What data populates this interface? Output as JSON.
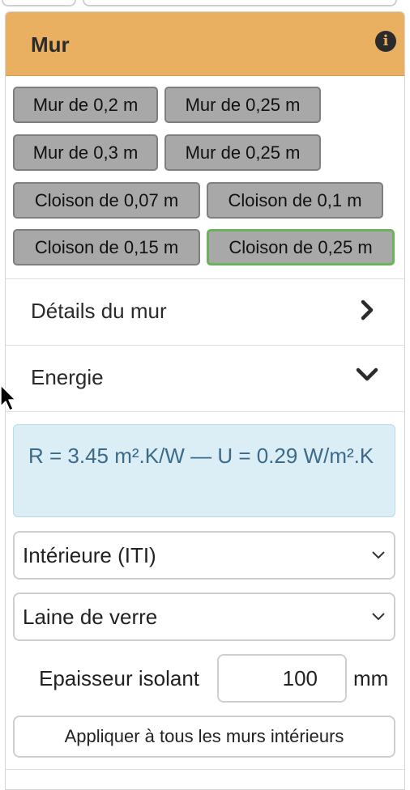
{
  "panel": {
    "title": "Mur",
    "header_color": "#e8b060"
  },
  "presets": [
    {
      "label": "Mur de 0,2 m",
      "selected": false
    },
    {
      "label": "Mur de 0,25 m",
      "selected": false
    },
    {
      "label": "Mur de 0,3 m",
      "selected": false
    },
    {
      "label": "Mur de 0,25 m",
      "selected": false
    },
    {
      "label": "Cloison de 0,07 m",
      "selected": false
    },
    {
      "label": "Cloison de 0,1 m",
      "selected": false
    },
    {
      "label": "Cloison de 0,15 m",
      "selected": false
    },
    {
      "label": "Cloison de 0,25 m",
      "selected": true
    }
  ],
  "sections": [
    {
      "label": "Détails du mur",
      "state": "collapsed",
      "icon": "chevron-right-icon"
    },
    {
      "label": "Energie",
      "state": "expanded",
      "icon": "chevron-down-icon"
    }
  ],
  "energy": {
    "result_text": "R = 3.45 m².K/W — U = 0.29 W/m².K",
    "insulation_position": "Intérieure (ITI)",
    "insulation_material": "Laine de verre",
    "thickness_label": "Epaisseur isolant",
    "thickness_value": "100",
    "thickness_unit": "mm",
    "apply_label": "Appliquer à tous les murs intérieurs"
  },
  "colors": {
    "preset_bg": "#a8a8a8",
    "selected_border": "#6bb25c",
    "result_bg": "#dbedf5",
    "result_text": "#3b6a8a"
  }
}
